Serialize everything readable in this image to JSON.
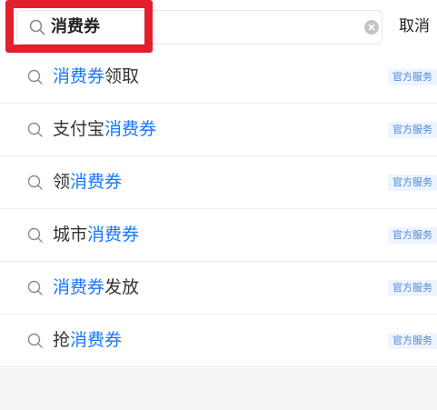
{
  "search": {
    "query": "消费券",
    "cancel_label": "取消"
  },
  "suggestions": [
    {
      "parts": [
        {
          "text": "消费券",
          "hl": true
        },
        {
          "text": "领取",
          "hl": false
        }
      ],
      "badge": "官方服务"
    },
    {
      "parts": [
        {
          "text": "支付宝",
          "hl": false
        },
        {
          "text": "消费券",
          "hl": true
        }
      ],
      "badge": "官方服务"
    },
    {
      "parts": [
        {
          "text": "领",
          "hl": false
        },
        {
          "text": "消费券",
          "hl": true
        }
      ],
      "badge": "官方服务"
    },
    {
      "parts": [
        {
          "text": "城市",
          "hl": false
        },
        {
          "text": "消费券",
          "hl": true
        }
      ],
      "badge": "官方服务"
    },
    {
      "parts": [
        {
          "text": "消费券",
          "hl": true
        },
        {
          "text": "发放",
          "hl": false
        }
      ],
      "badge": "官方服务"
    },
    {
      "parts": [
        {
          "text": "抢",
          "hl": false
        },
        {
          "text": "消费券",
          "hl": true
        }
      ],
      "badge": "官方服务"
    }
  ],
  "colors": {
    "highlight_text": "#1677ff",
    "annotation_frame": "#e31e2d",
    "badge_text": "#4a89dc",
    "badge_bg": "#eef4ff"
  },
  "icons": [
    "search-icon",
    "clear-icon"
  ]
}
